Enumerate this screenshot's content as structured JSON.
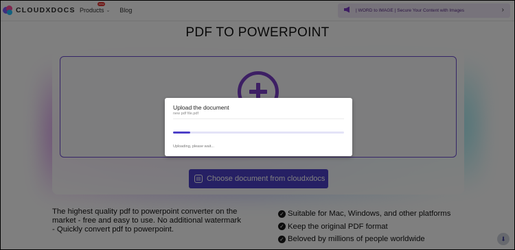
{
  "header": {
    "logo_text": "CLOUDXDOCS",
    "nav": [
      {
        "label": "Products",
        "badge": "new",
        "has_dropdown": true
      },
      {
        "label": "Blog"
      }
    ],
    "promo": {
      "icon": "megaphone-icon",
      "text": "| WORD to IMAGE | Secure Your Content with Images",
      "arrow": "›"
    }
  },
  "main": {
    "title": "PDF TO POWERPOINT",
    "upload_icon": "plus-circle-icon",
    "choose_button": "Choose document from cloudxdocs",
    "description": "The highest quality pdf to powerpoint converter on the market - free and easy to use. No additional watermark - Quickly convert pdf to powerpoint.",
    "features": [
      "Suitable for Mac, Windows, and other platforms",
      "Keep the original PDF format",
      "Beloved by millions of people worldwide"
    ]
  },
  "modal": {
    "title": "Upload the document",
    "file_name": "new pdf file.pdf",
    "status": "Uploading, please wait...",
    "progress": 0.1
  },
  "colors": {
    "accent": "#4d40c8",
    "icon_purple": "#7a3fc9",
    "promo_bg": "#efe7f6"
  }
}
